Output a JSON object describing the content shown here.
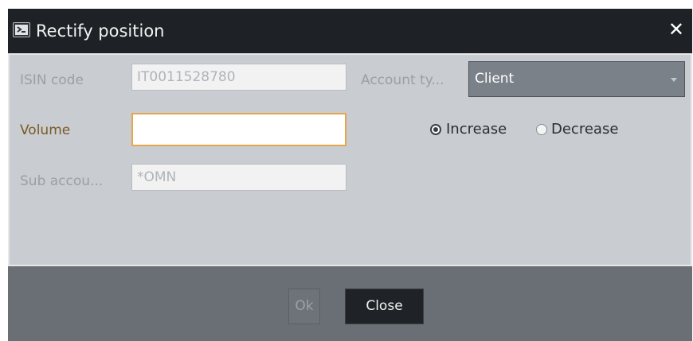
{
  "dialog": {
    "title": "Rectify position",
    "title_icon": "terminal-window-icon",
    "close_icon": "close-x-icon"
  },
  "form": {
    "isin_label": "ISIN code",
    "isin_value": "IT0011528780",
    "account_type_label": "Account ty...",
    "account_type_value": "Client",
    "volume_label": "Volume",
    "volume_value": "",
    "sub_account_label": "Sub accou...",
    "sub_account_value": "*OMN",
    "radio_increase": "Increase",
    "radio_decrease": "Decrease",
    "selected_radio": "Increase"
  },
  "footer": {
    "ok_label": "Ok",
    "close_label": "Close"
  },
  "colors": {
    "title_bar": "#1e2226",
    "panel": "#c9ccd0",
    "footer": "#6a6f75",
    "focus_border": "#e7a64b"
  }
}
